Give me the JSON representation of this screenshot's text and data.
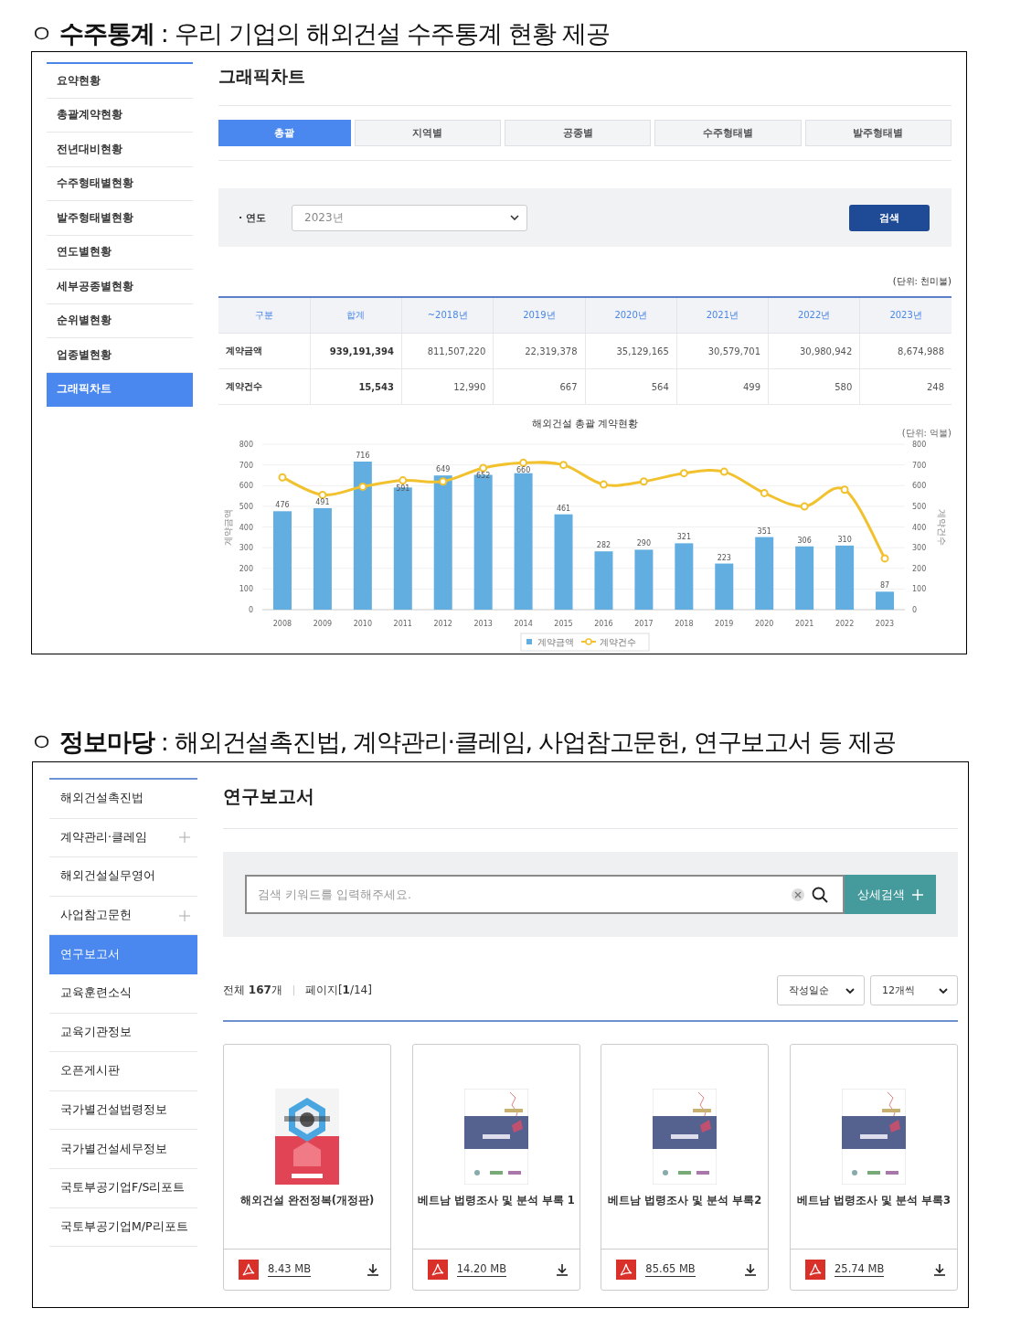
{
  "stats_section": {
    "heading": "ㅇ **수주통계** : 우리 기업의 해외건설 수주통계 현황 제공",
    "sidebar": [
      {
        "label": "요약현황",
        "selected": false
      },
      {
        "label": "총괄계약현황",
        "selected": false
      },
      {
        "label": "전년대비현황",
        "selected": false
      },
      {
        "label": "수주형태별현황",
        "selected": false
      },
      {
        "label": "발주형태별현황",
        "selected": false
      },
      {
        "label": "연도별현황",
        "selected": false
      },
      {
        "label": "세부공종별현황",
        "selected": false
      },
      {
        "label": "순위별현황",
        "selected": false
      },
      {
        "label": "업종별현황",
        "selected": false
      },
      {
        "label": "그래픽차트",
        "selected": true
      }
    ],
    "title": "그래픽차트",
    "tabs": [
      {
        "label": "총괄",
        "selected": true
      },
      {
        "label": "지역별",
        "selected": false
      },
      {
        "label": "공종별",
        "selected": false
      },
      {
        "label": "수주형태별",
        "selected": false
      },
      {
        "label": "발주형태별",
        "selected": false
      }
    ],
    "filter": {
      "label": "· 연도",
      "value": "2023년",
      "button": "검색"
    },
    "unit": "(단위: 천미불)",
    "table": {
      "columns": [
        "구분",
        "합계",
        "~2018년",
        "2019년",
        "2020년",
        "2021년",
        "2022년",
        "2023년"
      ],
      "rows": [
        [
          "계약금액",
          "939,191,394",
          "811,507,220",
          "22,319,378",
          "35,129,165",
          "30,579,701",
          "30,980,942",
          "8,674,988"
        ],
        [
          "계약건수",
          "15,543",
          "12,990",
          "667",
          "564",
          "499",
          "580",
          "248"
        ]
      ]
    },
    "chart": {
      "unit_note": "(단위: 억불)",
      "chart_data": {
        "type": "bar",
        "title": "해외건설 총괄 계약현황",
        "ylabel": "계약금액",
        "y2label": "계약건수",
        "categories": [
          "2008",
          "2009",
          "2010",
          "2011",
          "2012",
          "2013",
          "2014",
          "2015",
          "2016",
          "2017",
          "2018",
          "2019",
          "2020",
          "2021",
          "2022",
          "2023"
        ],
        "ylim": [
          0,
          800
        ],
        "yticks": [
          0,
          100,
          200,
          300,
          400,
          500,
          600,
          700,
          800
        ],
        "y2lim": [
          0,
          800
        ],
        "y2ticks": [
          0,
          100,
          200,
          300,
          400,
          500,
          600,
          700,
          800
        ],
        "grid": true,
        "legend": "bottom",
        "series": [
          {
            "name": "계약금액",
            "color": "#62aee0",
            "type": "bar",
            "values": [
              476,
              491,
              716,
              591,
              649,
              652,
              660,
              461,
              282,
              290,
              321,
              223,
              351,
              306,
              310,
              87
            ],
            "value_labels": [
              "476",
              "491",
              "716",
              "591",
              "649",
              "652",
              "660",
              "461",
              "282",
              "290",
              "321",
              "223",
              "351",
              "306",
              "310",
              "87"
            ]
          },
          {
            "name": "계약건수",
            "color": "#f2c12e",
            "type": "line",
            "marker": "circle",
            "values": [
              640,
              555,
              595,
              625,
              620,
              685,
              710,
              700,
              605,
              620,
              660,
              667,
              564,
              499,
              580,
              248
            ]
          }
        ]
      }
    }
  },
  "info_section": {
    "heading": "ㅇ **정보마당** : 해외건설촉진법, 계약관리·클레임, 사업참고문헌, 연구보고서 등 제공",
    "sidebar": [
      {
        "label": "해외건설촉진법",
        "selected": false,
        "expandable": false
      },
      {
        "label": "계약관리·클레임",
        "selected": false,
        "expandable": true
      },
      {
        "label": "해외건설실무영어",
        "selected": false,
        "expandable": false
      },
      {
        "label": "사업참고문헌",
        "selected": false,
        "expandable": true
      },
      {
        "label": "연구보고서",
        "selected": true,
        "expandable": false
      },
      {
        "label": "교육훈련소식",
        "selected": false,
        "expandable": false
      },
      {
        "label": "교육기관정보",
        "selected": false,
        "expandable": false
      },
      {
        "label": "오픈게시판",
        "selected": false,
        "expandable": false
      },
      {
        "label": "국가별건설법령정보",
        "selected": false,
        "expandable": false
      },
      {
        "label": "국가별건설세무정보",
        "selected": false,
        "expandable": false
      },
      {
        "label": "국토부공기업F/S리포트",
        "selected": false,
        "expandable": false
      },
      {
        "label": "국토부공기업M/P리포트",
        "selected": false,
        "expandable": false
      }
    ],
    "title": "연구보고서",
    "search": {
      "placeholder": "검색 키워드를 입력해주세요.",
      "button": "상세검색"
    },
    "total": "전체 **167**개",
    "page": "페이지[**1**/14]",
    "sort": {
      "order": "작성일순",
      "per_page": "12개씩"
    },
    "reports": [
      {
        "title": "해외건설 완전정복(개정판)",
        "size": "8.43 MB"
      },
      {
        "title": "베트남 법령조사 및 분석 부록 1",
        "size": "14.20 MB"
      },
      {
        "title": "베트남 법령조사 및 분석 부록2",
        "size": "85.65 MB"
      },
      {
        "title": "베트남 법령조사 및 분석 부록3",
        "size": "25.74 MB"
      }
    ]
  }
}
